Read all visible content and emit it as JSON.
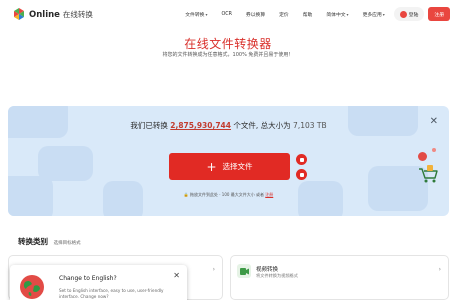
{
  "header": {
    "logo_brand": "Online",
    "logo_suffix": "在线转换",
    "nav": [
      {
        "label": "文件转换",
        "has_menu": true
      },
      {
        "label": "OCR",
        "has_menu": false
      },
      {
        "label": "券以换算",
        "has_menu": false
      },
      {
        "label": "定价",
        "has_menu": false
      },
      {
        "label": "帮助",
        "has_menu": false
      },
      {
        "label": "简体中文",
        "has_menu": true
      },
      {
        "label": "更多应用",
        "has_menu": true
      }
    ],
    "login_label": "登陆",
    "signup_label": "注册"
  },
  "hero": {
    "title": "在线文件转换器",
    "subtitle": "将您的文件转换成为任意格式，100% 免费并且易于使用！"
  },
  "upload": {
    "count_prefix": "我们已转换",
    "count_value": "2,875,930,744",
    "count_mid": "个文件, 总大小为",
    "count_size": "7,103 TB",
    "choose_label": "选择文件",
    "drop_text": "拖放文件到此处 · 100 最大文件大小 或者",
    "drop_link": "注册"
  },
  "categories": {
    "title": "转换类别",
    "subtitle": "选择目标格式",
    "items": [
      {
        "name": "",
        "desc": ""
      },
      {
        "name": "视频转换",
        "desc": "将文件转换为视频格式"
      }
    ]
  },
  "popup": {
    "title": "Change to English?",
    "body": "Set to English interface, easy to use, user-friendly interface. Change now?"
  },
  "colors": {
    "accent": "#e12a24",
    "card_bg": "#d9e9f9",
    "title_red": "#d9302b"
  }
}
